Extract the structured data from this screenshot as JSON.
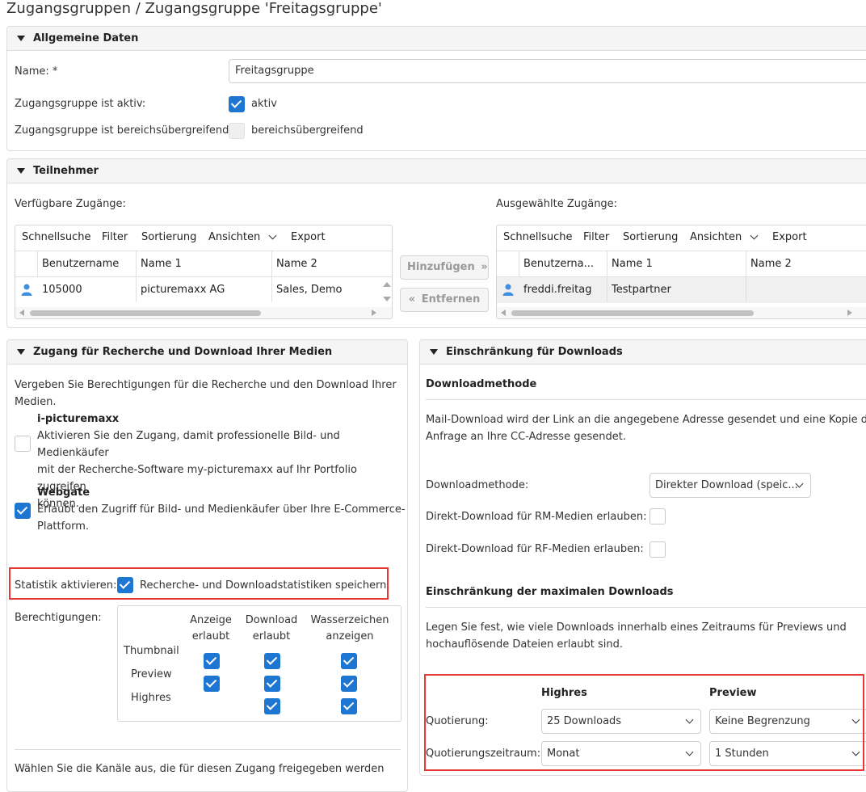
{
  "page": {
    "title": "Zugangsgruppen / Zugangsgruppe 'Freitagsgruppe'"
  },
  "general": {
    "header": "Allgemeine Daten",
    "name_label": "Name:",
    "required_mark": "*",
    "name_value": "Freitagsgruppe",
    "active_label": "Zugangsgruppe ist aktiv:",
    "active_checkbox_label": "aktiv",
    "active_checked": true,
    "cross_area_label": "Zugangsgruppe ist bereichsübergreifend:",
    "cross_area_checkbox_label": "bereichsübergreifend",
    "cross_area_checked": false
  },
  "participants": {
    "header": "Teilnehmer",
    "available_label": "Verfügbare Zugänge:",
    "selected_label": "Ausgewählte Zugänge:",
    "toolbar": [
      "Schnellsuche",
      "Filter",
      "Sortierung",
      "Ansichten",
      "Export"
    ],
    "add_button": "Hinzufügen",
    "remove_button": "Entfernen",
    "available_grid": {
      "columns": [
        "Benutzername",
        "Name 1",
        "Name 2"
      ],
      "rows": [
        {
          "username": "105000",
          "name1": "picturemaxx AG",
          "name2": "Sales, Demo"
        }
      ]
    },
    "selected_grid": {
      "columns": [
        "Benutzerna...",
        "Name 1",
        "Name 2"
      ],
      "rows": [
        {
          "username": "freddi.freitag",
          "name1": "Testpartner",
          "name2": ""
        }
      ]
    }
  },
  "access": {
    "header": "Zugang für Recherche und Download Ihrer Medien",
    "intro_line1": "Vergeben Sie Berechtigungen für die Recherche und den Download Ihrer",
    "intro_line2": "Medien.",
    "ipicturemaxx": {
      "title": "i-picturemaxx",
      "line1": "Aktivieren Sie den Zugang, damit professionelle Bild- und Medienkäufer",
      "line2": "mit der Recherche-Software my-picturemaxx auf Ihr Portfolio zugreifen",
      "line3": "können.",
      "checked": false
    },
    "webgate": {
      "title": "Webgate",
      "line1": "Erlaubt den Zugriff für Bild- und Medienkäufer über Ihre E-Commerce-",
      "line2": "Plattform.",
      "checked": true
    },
    "statistics_label": "Statistik aktivieren:",
    "statistics_checkbox_label": "Recherche- und Downloadstatistiken speichern.",
    "statistics_checked": true,
    "permissions_label": "Berechtigungen:",
    "perm_columns": [
      {
        "line1": "Anzeige",
        "line2": "erlaubt"
      },
      {
        "line1": "Download",
        "line2": "erlaubt"
      },
      {
        "line1": "Wasserzeichen",
        "line2": "anzeigen"
      }
    ],
    "perm_rows": [
      "Thumbnail",
      "Preview",
      "Highres"
    ],
    "channels_text": "Wählen Sie die Kanäle aus, die für diesen Zugang freigegeben werden"
  },
  "downloads": {
    "header": "Einschränkung für Downloads",
    "method_title": "Downloadmethode",
    "method_desc_line1": "Mail-Download wird der Link an die angegebene Adresse gesendet und eine Kopie der",
    "method_desc_line2": "Anfrage an Ihre CC-Adresse gesendet.",
    "method_label": "Downloadmethode:",
    "method_value": "Direkter Download (speic...",
    "rm_label": "Direkt-Download für RM-Medien erlauben:",
    "rm_checked": false,
    "rf_label": "Direkt-Download für RF-Medien erlauben:",
    "rf_checked": false,
    "limit_title": "Einschränkung der maximalen Downloads",
    "limit_desc_line1": "Legen Sie fest, wie viele Downloads innerhalb eines Zeitraums für Previews und",
    "limit_desc_line2": "hochauflösende Dateien erlaubt sind.",
    "col_highres": "Highres",
    "col_preview": "Preview",
    "quota_label": "Quotierung:",
    "quota_period_label": "Quotierungszeitraum:",
    "quota_highres": "25 Downloads",
    "quota_preview": "Keine Begrenzung",
    "period_highres": "Monat",
    "period_preview": "1 Stunden"
  }
}
